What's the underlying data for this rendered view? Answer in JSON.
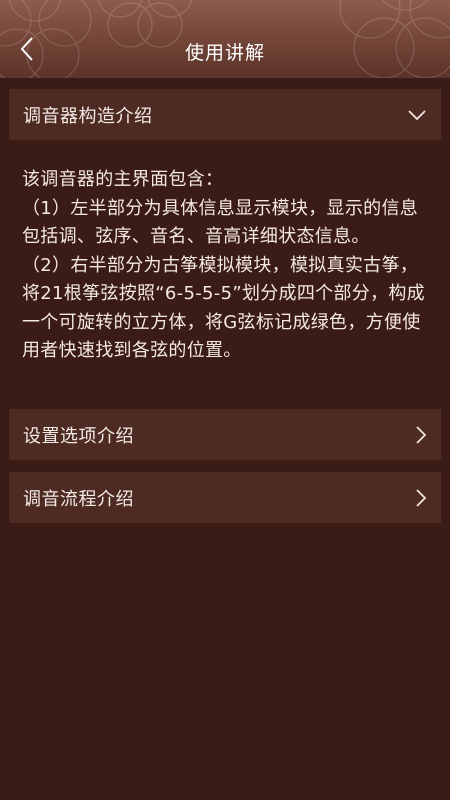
{
  "header": {
    "title": "使用讲解",
    "back_icon": "chevron-left-icon"
  },
  "sections": [
    {
      "label": "调音器构造介绍",
      "icon": "chevron-down-icon",
      "expanded": true,
      "content": {
        "intro": "该调音器的主界面包含：",
        "item1": "（1）左半部分为具体信息显示模块，显示的信息包括调、弦序、音名、音高详细状态信息。",
        "item2": "（2）右半部分为古筝模拟模块，模拟真实古筝，将21根筝弦按照“6-5-5-5”划分成四个部分，构成一个可旋转的立方体，将G弦标记成绿色，方便使用者快速找到各弦的位置。"
      }
    },
    {
      "label": "设置选项介绍",
      "icon": "chevron-right-icon",
      "expanded": false
    },
    {
      "label": "调音流程介绍",
      "icon": "chevron-right-icon",
      "expanded": false
    }
  ],
  "colors": {
    "background": "#3b1b15",
    "row_background": "#4d2a22",
    "header_top": "#8d5c4e",
    "header_bottom": "#5b3328",
    "text": "#f3e8e2"
  }
}
